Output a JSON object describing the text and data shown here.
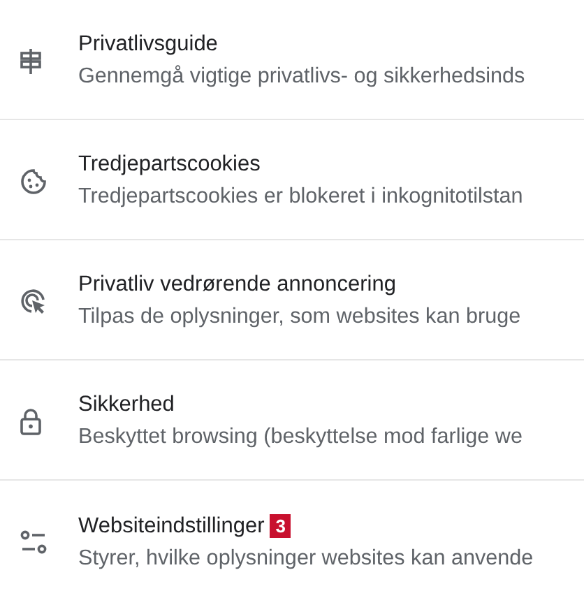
{
  "items": [
    {
      "kind": "signpost",
      "title": "Privatlivsguide",
      "description": "Gennemgå vigtige privatlivs- og sikkerhedsinds"
    },
    {
      "kind": "cookie",
      "title": "Tredjepartscookies",
      "description": "Tredjepartscookies er blokeret i inkognitotilstan"
    },
    {
      "kind": "ads",
      "title": "Privatliv vedrørende annoncering",
      "description": "Tilpas de oplysninger, som websites kan bruge"
    },
    {
      "kind": "lock",
      "title": "Sikkerhed",
      "description": "Beskyttet browsing (beskyttelse mod farlige we"
    },
    {
      "kind": "tune",
      "title": "Websiteindstillinger",
      "badge": "3",
      "description": "Styrer, hvilke oplysninger websites kan anvende"
    }
  ]
}
